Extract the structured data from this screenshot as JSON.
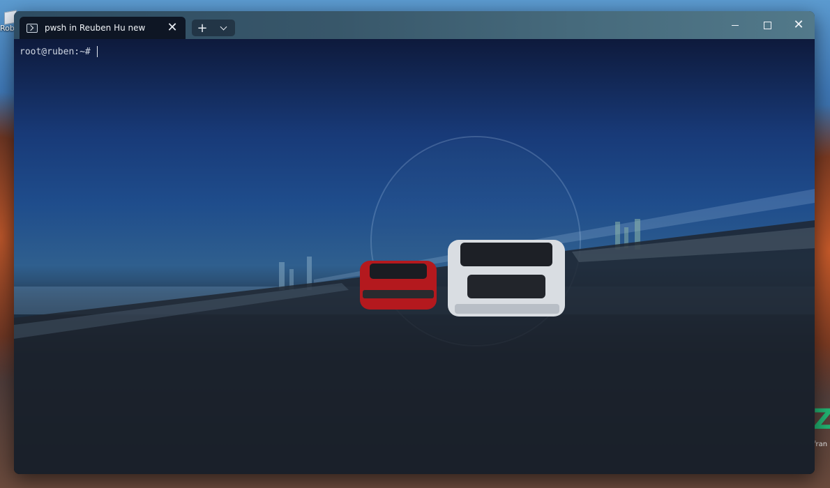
{
  "desktop": {
    "icon_label": "Rob",
    "corner_text": "fran"
  },
  "window": {
    "tab": {
      "title": "pwsh in Reuben Hu new",
      "close_glyph": "✕"
    },
    "new_tab_glyph": "+",
    "caption": {
      "minimize": "minimize-icon",
      "maximize": "maximize-icon",
      "close_glyph": "✕"
    }
  },
  "terminal": {
    "prompt": "root@ruben:~#",
    "input": ""
  },
  "colors": {
    "tab_bg": "#0e1624",
    "titlebar": "#38576a",
    "prompt_text": "#cfd6e2"
  }
}
